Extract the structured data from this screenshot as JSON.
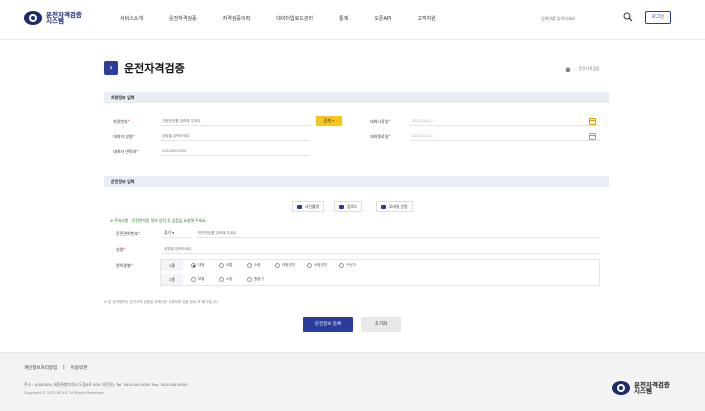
{
  "header": {
    "logo_text": "운전자격검증 시스템",
    "nav": [
      "서비스소개",
      "운전자격검증",
      "자격검증이력",
      "데이터업로드관리",
      "통계",
      "오픈API",
      "고객지원"
    ],
    "search_placeholder": "검색어를 입력하세요",
    "login_label": "로그인"
  },
  "page": {
    "title_badge": "›",
    "title": "운전자격검증",
    "breadcrumb": [
      "운전자격검증"
    ]
  },
  "section1": {
    "title": "차량정보 입력",
    "fields": {
      "car_number_label": "차량번호",
      "car_number_placeholder": "차량번호를 입력해 주세요",
      "search_btn": "검색",
      "owner_label": "대여자 성명",
      "owner_placeholder": "성명을 입력하세요",
      "contact_label": "대여자 연락처",
      "contact_placeholder": "010-0000-0000",
      "rent_start_label": "대여시작일",
      "rent_start_value": "2023-04-12",
      "rent_end_label": "대여종료일",
      "rent_end_value": "2023-04-12"
    }
  },
  "section2": {
    "title": "운전정보 입력",
    "photo_btns": [
      "사진촬영",
      "업로드",
      "모바일 인증"
    ],
    "notice": "※ 주의사항 : 운전면허증 정보 입력 후 검증을 요청해 주세요.",
    "license_no_label": "운전면허번호",
    "license_region": "경기",
    "license_no_placeholder": "면허번호를 입력해 주세요",
    "name_label": "성명",
    "name_placeholder": "성명을 입력하세요",
    "license_type_label": "면허종별",
    "row1_label": "1종",
    "row1_options": [
      "대형",
      "보통",
      "소형",
      "대형견인",
      "소형견인",
      "구난차"
    ],
    "row2_label": "2종",
    "row2_options": [
      "보통",
      "소형",
      "원동기"
    ]
  },
  "footer_note": "※ 본 입력정보는 운전자격 검증을 위해서만 사용되며 검증 완료 후 폐기됩니다.",
  "actions": {
    "submit": "운전정보 등록",
    "reset": "초기화"
  },
  "footer": {
    "links": [
      "개인정보처리방침",
      "이용약관"
    ],
    "address": "주소 : (000000) 세종특별자치시 도움6로 000 (어진동)   Tel. 044-000-0000   Fax. 044-000-0000",
    "copyright": "Copyright © 2023 MOLIT. All Rights Reserved.",
    "logo_text": "운전자격검증 시스템"
  }
}
